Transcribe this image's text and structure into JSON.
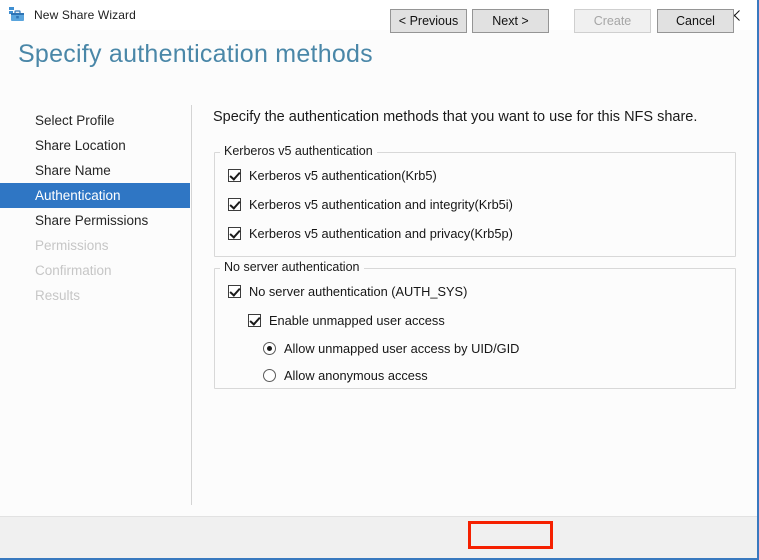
{
  "window": {
    "title": "New Share Wizard",
    "icon": "share-folder-icon",
    "accent_color": "#3979bf",
    "controls": {
      "minimize": "—",
      "maximize": "☐",
      "close": "✕"
    }
  },
  "header": {
    "page_title": "Specify authentication methods",
    "title_color": "#4a87a8"
  },
  "sidebar": {
    "selected_color": "#2f76c4",
    "items": [
      {
        "label": "Select Profile",
        "state": "completed"
      },
      {
        "label": "Share Location",
        "state": "completed"
      },
      {
        "label": "Share Name",
        "state": "completed"
      },
      {
        "label": "Authentication",
        "state": "selected"
      },
      {
        "label": "Share Permissions",
        "state": "completed"
      },
      {
        "label": "Permissions",
        "state": "disabled"
      },
      {
        "label": "Confirmation",
        "state": "disabled"
      },
      {
        "label": "Results",
        "state": "disabled"
      }
    ]
  },
  "main": {
    "intro": "Specify the authentication methods that you want to use for this NFS share.",
    "groups": [
      {
        "legend": "Kerberos v5 authentication",
        "options": [
          {
            "type": "checkbox",
            "label": "Kerberos v5 authentication(Krb5)",
            "checked": true
          },
          {
            "type": "checkbox",
            "label": "Kerberos v5 authentication and integrity(Krb5i)",
            "checked": true
          },
          {
            "type": "checkbox",
            "label": "Kerberos v5 authentication and privacy(Krb5p)",
            "checked": true
          }
        ]
      },
      {
        "legend": "No server authentication",
        "options": [
          {
            "type": "checkbox",
            "label": "No server authentication (AUTH_SYS)",
            "checked": true
          },
          {
            "type": "checkbox",
            "label": "Enable unmapped user access",
            "checked": true
          },
          {
            "type": "radio",
            "label": "Allow unmapped user access by UID/GID",
            "selected": true
          },
          {
            "type": "radio",
            "label": "Allow anonymous access",
            "selected": false
          }
        ]
      }
    ]
  },
  "footer": {
    "buttons": [
      {
        "label": "< Previous",
        "enabled": true
      },
      {
        "label": "Next >",
        "enabled": true,
        "focused": true,
        "annotated": true
      },
      {
        "label": "Create",
        "enabled": false
      },
      {
        "label": "Cancel",
        "enabled": true
      }
    ],
    "annotation_color": "#f52000"
  }
}
